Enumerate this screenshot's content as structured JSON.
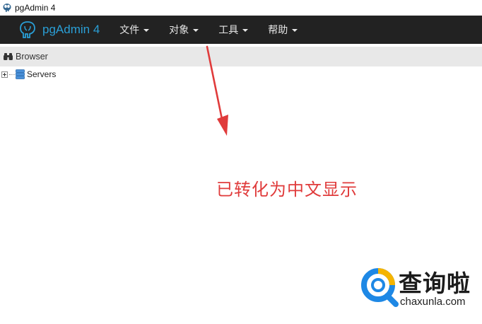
{
  "window": {
    "title": "pgAdmin 4",
    "icon": "elephant-icon"
  },
  "navbar": {
    "brand": "pgAdmin 4",
    "brand_icon": "elephant-icon",
    "brand_color": "#2a9fd6",
    "background": "#222222",
    "menu": [
      {
        "label": "文件"
      },
      {
        "label": "对象"
      },
      {
        "label": "工具"
      },
      {
        "label": "帮助"
      }
    ]
  },
  "browser_panel": {
    "title": "Browser",
    "icon": "binoculars-icon",
    "tree": [
      {
        "label": "Servers",
        "icon": "server-group-icon",
        "expanded": false
      }
    ]
  },
  "annotation": {
    "text": "已转化为中文显示",
    "color": "#e03b3b"
  },
  "watermark": {
    "title": "查询啦",
    "url": "chaxunla.com",
    "colors": [
      "#1e88e5",
      "#f5b400"
    ]
  }
}
